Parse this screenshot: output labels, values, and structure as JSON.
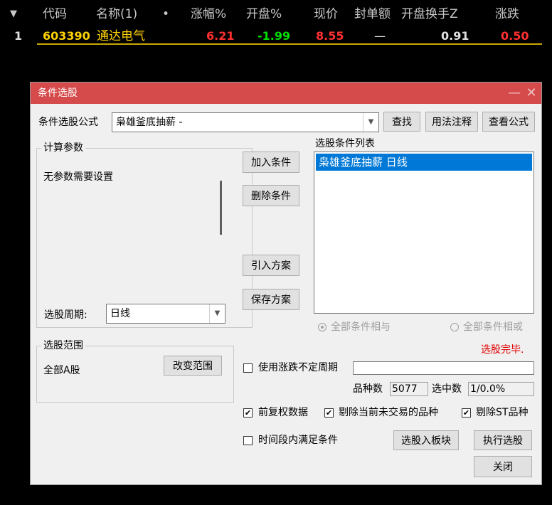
{
  "table": {
    "headers": {
      "sort_icon": "▼",
      "code": "代码",
      "name": "名称(1)",
      "dot": "•",
      "change_pct": "涨幅%",
      "open_pct": "开盘%",
      "price": "现价",
      "seal_amount": "封单额",
      "open_turnover": "开盘换手Z",
      "change": "涨跌"
    },
    "row": {
      "index": "1",
      "code": "603390",
      "name": "通达电气",
      "change_pct": "6.21",
      "open_pct": "-1.99",
      "price": "8.55",
      "seal_amount": "—",
      "open_turnover": "0.91",
      "change": "0.50"
    }
  },
  "dialog": {
    "title": "条件选股",
    "minimize": "—",
    "close": "✕",
    "formula_label": "条件选股公式",
    "formula_value": "枭雄釜底抽薪 -",
    "find_btn": "查找",
    "usage_btn": "用法注释",
    "view_formula_btn": "查看公式",
    "params_group": "计算参数",
    "no_params": "无参数需要设置",
    "period_label": "选股周期:",
    "period_value": "日线",
    "add_btn": "加入条件",
    "delete_btn": "删除条件",
    "import_btn": "引入方案",
    "save_btn": "保存方案",
    "list_label": "选股条件列表",
    "list_items": [
      "枭雄釜底抽薪  日线"
    ],
    "radio_and": "全部条件相与",
    "radio_or": "全部条件相或",
    "status": "选股完毕.",
    "range_group": "选股范围",
    "range_value": "全部A股",
    "change_range_btn": "改变范围",
    "use_variable_period": "使用涨跌不定周期",
    "count_label": "品种数",
    "count_value": "5077",
    "selected_label": "选中数",
    "selected_value": "1/0.0%",
    "forward_adjust": "前复权数据",
    "exclude_untraded": "剔除当前未交易的品种",
    "exclude_st": "剔除ST品种",
    "time_range": "时间段内满足条件",
    "to_block_btn": "选股入板块",
    "execute_btn": "执行选股",
    "close_btn": "关闭"
  },
  "colors": {
    "title_bar": "#d54a4a",
    "up_red": "#ff3030",
    "down_green": "#00e000",
    "code_yellow": "#ffd200",
    "selection_blue": "#0078d7",
    "status_red": "#e00000"
  },
  "icons": {
    "sort": "triangle-down",
    "dropdown": "chevron-down",
    "check": "checkmark"
  }
}
